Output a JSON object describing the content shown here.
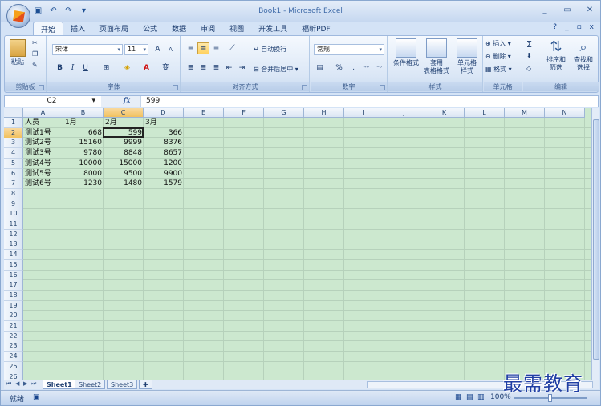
{
  "app": {
    "title": "Book1 - Microsoft Excel",
    "window_controls": [
      "_",
      "▭",
      "✕"
    ],
    "help_controls": [
      "?",
      "_",
      "▫",
      "x"
    ]
  },
  "quick_access": {
    "icons": [
      "save-icon",
      "undo-icon",
      "redo-icon",
      "customize-icon"
    ]
  },
  "tabs": [
    {
      "label": "开始",
      "active": true
    },
    {
      "label": "插入"
    },
    {
      "label": "页面布局"
    },
    {
      "label": "公式"
    },
    {
      "label": "数据"
    },
    {
      "label": "审阅"
    },
    {
      "label": "视图"
    },
    {
      "label": "开发工具"
    },
    {
      "label": "福昕PDF"
    }
  ],
  "ribbon": {
    "clipboard": {
      "label": "剪贴板",
      "paste": "粘贴"
    },
    "font": {
      "label": "字体",
      "font_name": "宋体",
      "font_size": "11",
      "bold": "B",
      "italic": "I",
      "underline": "U",
      "grow": "A",
      "shrink": "A",
      "wen": "变"
    },
    "alignment": {
      "label": "对齐方式",
      "wrap": "自动换行",
      "merge": "合并后居中"
    },
    "number": {
      "label": "数字",
      "format": "常规",
      "percent": "%",
      "comma": ","
    },
    "styles": {
      "label": "样式",
      "conditional": "条件格式",
      "table1": "套用",
      "table2": "表格格式",
      "cell1": "单元格",
      "cell2": "样式"
    },
    "cells": {
      "label": "单元格",
      "insert": "插入",
      "delete": "删除",
      "format": "格式"
    },
    "editing": {
      "label": "编辑",
      "sort1": "排序和",
      "sort2": "筛选",
      "find1": "查找和",
      "find2": "选择"
    }
  },
  "formula_bar": {
    "name_box": "C2",
    "fx": "fx",
    "formula": "599"
  },
  "columns": [
    "A",
    "B",
    "C",
    "D",
    "E",
    "F",
    "G",
    "H",
    "I",
    "J",
    "K",
    "L",
    "M",
    "N"
  ],
  "rows": [
    "1",
    "2",
    "3",
    "4",
    "5",
    "6",
    "7",
    "8",
    "9",
    "10",
    "11",
    "12",
    "13",
    "14",
    "15",
    "16",
    "17",
    "18",
    "19",
    "20",
    "21",
    "22",
    "23",
    "24",
    "25",
    "26"
  ],
  "table": {
    "header": [
      "人员",
      "1月",
      "2月",
      "3月"
    ],
    "rows": [
      [
        "测试1号",
        "668",
        "599",
        "366"
      ],
      [
        "测试2号",
        "15160",
        "9999",
        "8376"
      ],
      [
        "测试3号",
        "9780",
        "8848",
        "8657"
      ],
      [
        "测试4号",
        "10000",
        "15000",
        "1200"
      ],
      [
        "测试5号",
        "8000",
        "9500",
        "9900"
      ],
      [
        "测试6号",
        "1230",
        "1480",
        "1579"
      ]
    ]
  },
  "sheets": [
    {
      "label": "Sheet1",
      "active": true
    },
    {
      "label": "Sheet2"
    },
    {
      "label": "Sheet3"
    }
  ],
  "status": {
    "text": "就绪",
    "zoom": "100%"
  },
  "watermark": "最需教育"
}
